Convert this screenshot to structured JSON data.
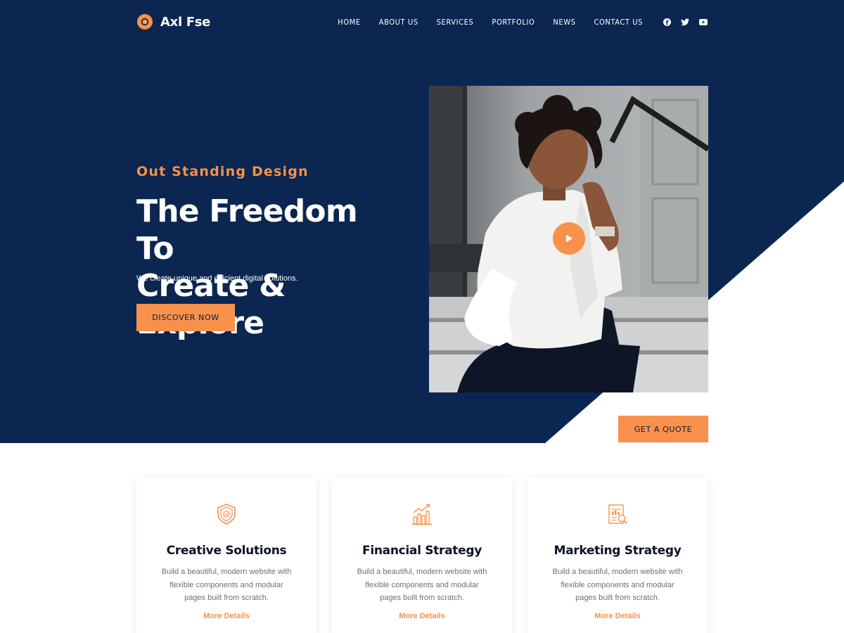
{
  "brand": {
    "name": "Axl Fse",
    "logo_icon": "donut-logo-icon",
    "accent": "#f7914b",
    "navy": "#0b2650"
  },
  "nav": {
    "items": [
      "HOME",
      "ABOUT US",
      "SERVICES",
      "PORTFOLIO",
      "NEWS",
      "CONTACT US"
    ],
    "social": [
      "facebook-icon",
      "twitter-icon",
      "youtube-icon"
    ]
  },
  "hero": {
    "eyebrow": "Out Standing Design",
    "title_line1": "The Freedom To",
    "title_line2": "Create & Explore",
    "subtitle": "We create unique and efficient digital solutions.",
    "cta_label": "DISCOVER NOW",
    "quote_label": "GET A QUOTE",
    "media_icon": "play-icon"
  },
  "cards": [
    {
      "icon": "shield-icon",
      "title": "Creative Solutions",
      "text": "Build a beautiful, modern website with flexible components and modular pages built from scratch.",
      "link": "More Details"
    },
    {
      "icon": "bar-chart-icon",
      "title": "Financial Strategy",
      "text": "Build a beautiful, modern website with flexible components and modular pages built from scratch.",
      "link": "More Details"
    },
    {
      "icon": "report-search-icon",
      "title": "Marketing Strategy",
      "text": "Build a beautiful, modern website with flexible components and modular pages built from scratch.",
      "link": "More Details"
    }
  ]
}
